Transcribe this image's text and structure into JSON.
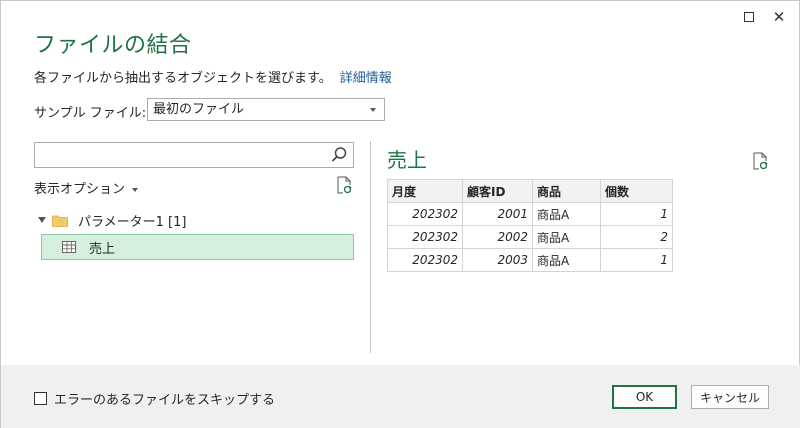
{
  "window": {
    "title": "ファイルの結合",
    "maximize_icon": "maximize-icon",
    "close_icon": "close-icon",
    "close_glyph": "✕"
  },
  "header": {
    "instruction": "各ファイルから抽出するオブジェクトを選びます。",
    "detail_link": "詳細情報"
  },
  "sample_file": {
    "label": "サンプル ファイル:",
    "selected": "最初のファイル"
  },
  "navigator": {
    "search_placeholder": "",
    "display_options_label": "表示オプション",
    "tree": {
      "folder_label": "パラメーター1 [1]",
      "items": [
        {
          "label": "売上",
          "selected": true
        }
      ]
    }
  },
  "preview": {
    "title": "売上",
    "columns": [
      "月度",
      "顧客ID",
      "商品",
      "個数"
    ],
    "rows": [
      [
        "202302",
        "2001",
        "商品A",
        "1"
      ],
      [
        "202302",
        "2002",
        "商品A",
        "2"
      ],
      [
        "202302",
        "2003",
        "商品A",
        "1"
      ]
    ]
  },
  "footer": {
    "skip_errors_label": "エラーのあるファイルをスキップする",
    "skip_errors_checked": false,
    "ok_label": "OK",
    "cancel_label": "キャンセル"
  },
  "colors": {
    "accent": "#217346",
    "selection_bg": "#d5efdf",
    "link": "#1e5b9a"
  }
}
